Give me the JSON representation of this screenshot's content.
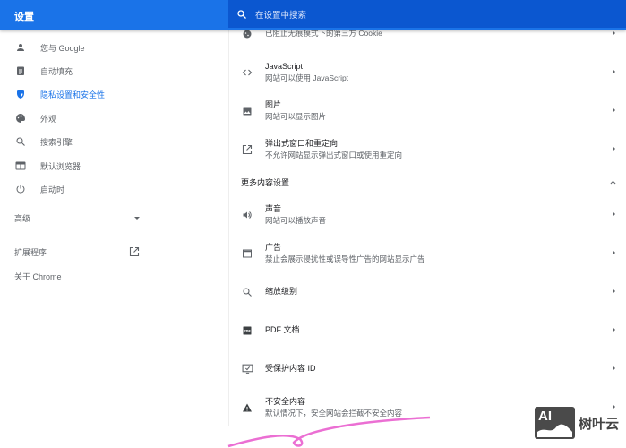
{
  "header": {
    "title": "设置",
    "search_placeholder": "在设置中搜索"
  },
  "sidebar": {
    "items": [
      {
        "label": "您与 Google",
        "icon": "person-icon"
      },
      {
        "label": "自动填充",
        "icon": "clipboard-icon"
      },
      {
        "label": "隐私设置和安全性",
        "icon": "shield-icon",
        "active": true
      },
      {
        "label": "外观",
        "icon": "palette-icon"
      },
      {
        "label": "搜索引擎",
        "icon": "search-icon"
      },
      {
        "label": "默认浏览器",
        "icon": "browser-icon"
      },
      {
        "label": "启动时",
        "icon": "power-icon"
      }
    ],
    "advanced": "高级",
    "extensions": "扩展程序",
    "about": "关于 Chrome"
  },
  "content": {
    "rows_top": [
      {
        "title": "",
        "subtitle": "已阻止无痕模式下的第三方 Cookie",
        "icon": "cookie-icon"
      },
      {
        "title": "JavaScript",
        "subtitle": "网站可以使用 JavaScript",
        "icon": "code-icon"
      },
      {
        "title": "图片",
        "subtitle": "网站可以显示图片",
        "icon": "image-icon"
      },
      {
        "title": "弹出式窗口和重定向",
        "subtitle": "不允许网站显示弹出式窗口或使用重定向",
        "icon": "open-in-new-icon"
      }
    ],
    "section_title": "更多内容设置",
    "rows_more": [
      {
        "title": "声音",
        "subtitle": "网站可以播放声音",
        "icon": "volume-icon"
      },
      {
        "title": "广告",
        "subtitle": "禁止会展示侵扰性或误导性广告的网站显示广告",
        "icon": "window-icon"
      },
      {
        "title": "缩放级别",
        "subtitle": "",
        "icon": "zoom-icon"
      },
      {
        "title": "PDF 文档",
        "subtitle": "",
        "icon": "pdf-icon"
      },
      {
        "title": "受保护内容 ID",
        "subtitle": "",
        "icon": "protected-content-icon"
      },
      {
        "title": "不安全内容",
        "subtitle": "默认情况下，安全网站会拦截不安全内容",
        "icon": "warning-icon"
      }
    ]
  },
  "watermark": {
    "text": "树叶云",
    "logo_text": "AI"
  },
  "colors": {
    "header": "#1a73e8",
    "search": "#0b57d0",
    "accent": "#1a73e8",
    "scribble": "#e64bc8"
  }
}
